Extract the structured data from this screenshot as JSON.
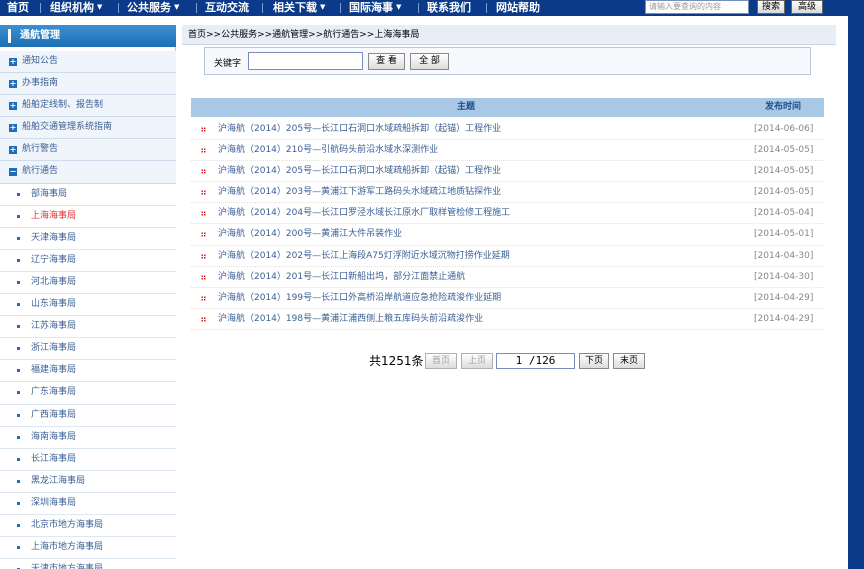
{
  "topnav": {
    "items": [
      {
        "label": "首页",
        "caret": ""
      },
      {
        "label": "组织机构",
        "caret": "▼"
      },
      {
        "label": "公共服务",
        "caret": "▼"
      },
      {
        "label": "互动交流",
        "caret": ""
      },
      {
        "label": "相关下载",
        "caret": "▼"
      },
      {
        "label": "国际海事",
        "caret": "▼"
      },
      {
        "label": "联系我们",
        "caret": ""
      },
      {
        "label": "网站帮助",
        "caret": ""
      }
    ],
    "search_placeholder": "请输入要查询的内容",
    "search_button": "搜索",
    "advanced_button": "高级"
  },
  "sidebar": {
    "title": "通航管理",
    "sections": [
      {
        "icon": "+",
        "label": "通知公告"
      },
      {
        "icon": "+",
        "label": "办事指南"
      },
      {
        "icon": "+",
        "label": "船舶定线制、报告制"
      },
      {
        "icon": "+",
        "label": "船舶交通管理系统指南"
      },
      {
        "icon": "+",
        "label": "航行警告"
      },
      {
        "icon": "−",
        "label": "航行通告"
      }
    ],
    "subitems": [
      "部海事局",
      "上海海事局",
      "天津海事局",
      "辽宁海事局",
      "河北海事局",
      "山东海事局",
      "江苏海事局",
      "浙江海事局",
      "福建海事局",
      "广东海事局",
      "广西海事局",
      "海南海事局",
      "长江海事局",
      "黑龙江海事局",
      "深圳海事局",
      "北京市地方海事局",
      "上海市地方海事局",
      "天津市地方海事局"
    ],
    "active_sub": "上海海事局"
  },
  "breadcrumb": "首页>>公共服务>>通航管理>>航行通告>>上海海事局",
  "search_form": {
    "label": "关键字",
    "value": "",
    "search_button": "查 看",
    "all_button": "全 部"
  },
  "table": {
    "col_subject": "主题",
    "col_date": "发布时间",
    "rows": [
      {
        "title": "沪海航（2014）205号—长江口石洞口水域疏船拆卸（起锚）工程作业",
        "date": "[2014-06-06]"
      },
      {
        "title": "沪海航（2014）210号—引航码头前沿水域水深测作业",
        "date": "[2014-05-05]"
      },
      {
        "title": "沪海航（2014）205号—长江口石洞口水域疏船拆卸（起锚）工程作业",
        "date": "[2014-05-05]"
      },
      {
        "title": "沪海航（2014）203号—黄浦江下游军工路码头水域疏江地质钻探作业",
        "date": "[2014-05-05]"
      },
      {
        "title": "沪海航（2014）204号—长江口罗泾水域长江原水厂取样管检修工程施工",
        "date": "[2014-05-04]"
      },
      {
        "title": "沪海航（2014）200号—黄浦江大件吊装作业",
        "date": "[2014-05-01]"
      },
      {
        "title": "沪海航（2014）202号—长江上海段A75灯浮附近水域沉物打捞作业延期",
        "date": "[2014-04-30]"
      },
      {
        "title": "沪海航（2014）201号—长江口新船出坞，部分江面禁止通航",
        "date": "[2014-04-30]"
      },
      {
        "title": "沪海航（2014）199号—长江口外高桥沿岸航道应急抢险疏浚作业延期",
        "date": "[2014-04-29]"
      },
      {
        "title": "沪海航（2014）198号—黄浦江浦西侧上粮五库码头前沿疏浚作业",
        "date": "[2014-04-29]"
      }
    ]
  },
  "pager": {
    "total": "共1251条",
    "first": "首页",
    "prev": "上页",
    "page": "1 /126",
    "next": "下页",
    "last": "末页"
  }
}
